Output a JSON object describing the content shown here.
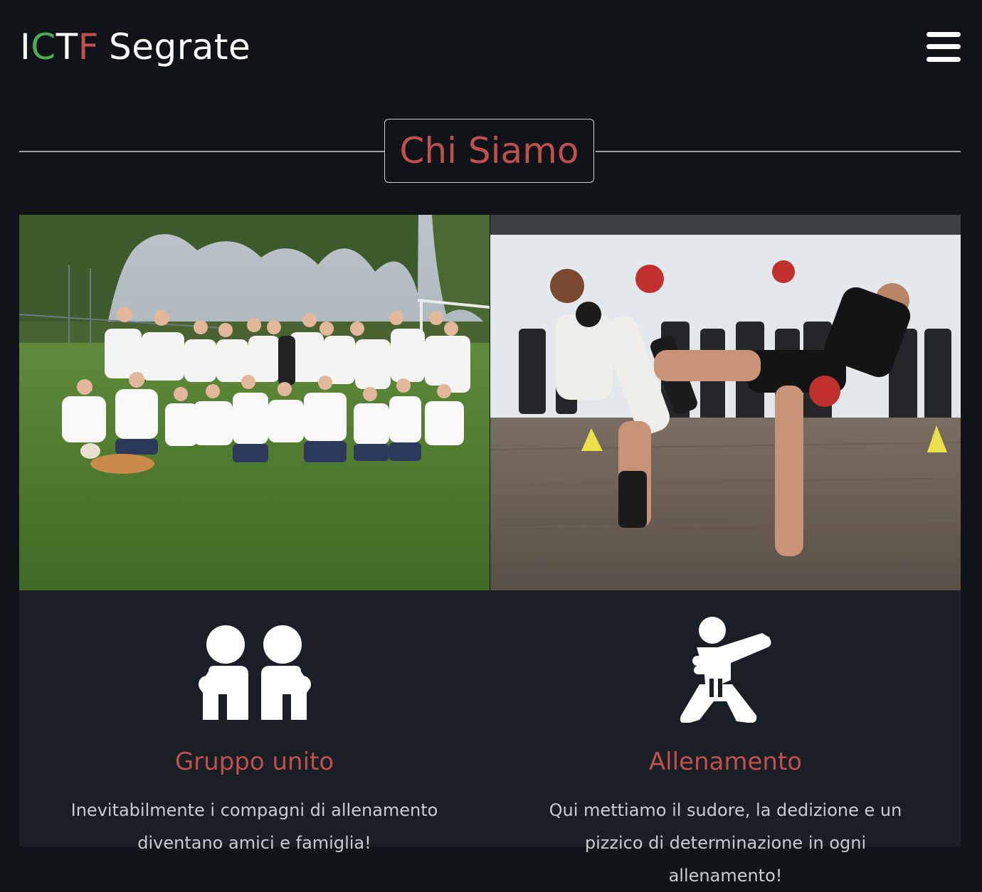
{
  "header": {
    "logo": [
      {
        "text": "I",
        "color": "#ffffff"
      },
      {
        "text": "C",
        "color": "#4caf50"
      },
      {
        "text": "T",
        "color": "#ffffff"
      },
      {
        "text": "F",
        "color": "#c0504d"
      },
      {
        "text": "Segrate",
        "color": "#ffffff"
      }
    ],
    "menu_icon": "hamburger-menu-icon"
  },
  "section": {
    "title": "Chi Siamo"
  },
  "photos": [
    {
      "subject": "group-photo",
      "icon": "group-photo"
    },
    {
      "subject": "kickboxing-training-photo",
      "icon": "kickboxing-photo"
    }
  ],
  "cards": [
    {
      "icon": "group-people-icon",
      "title": "Gruppo unito",
      "text": "Inevitabilmente i compagni di allenamento diventano amici e famiglia!"
    },
    {
      "icon": "martial-arts-punch-icon",
      "title": "Allenamento",
      "text": "Qui mettiamo il sudore, la dedizione e un pizzico di determinazione in ogni allenamento!"
    }
  ],
  "colors": {
    "background": "#101419",
    "card_background": "#1a1f25",
    "accent_red": "#c0504d",
    "accent_green": "#4caf50"
  }
}
